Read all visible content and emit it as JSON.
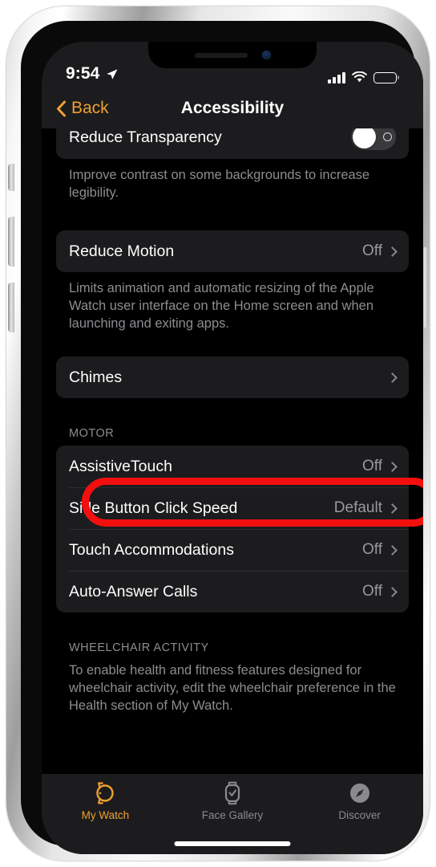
{
  "status_bar": {
    "time": "9:54",
    "location_icon": "location-arrow-icon",
    "signal_icon": "cellular-signal-icon",
    "wifi_icon": "wifi-icon",
    "battery_icon": "battery-full-icon"
  },
  "nav_bar": {
    "back_label": "Back",
    "back_icon": "chevron-left-icon",
    "title": "Accessibility",
    "accent_color": "#f0a030"
  },
  "sections": [
    {
      "rows": [
        {
          "label": "Reduce Transparency",
          "control": "toggle",
          "toggle_state": "off"
        }
      ],
      "footnote": "Improve contrast on some backgrounds to increase legibility."
    },
    {
      "rows": [
        {
          "label": "Reduce Motion",
          "value": "Off",
          "control": "disclosure"
        }
      ],
      "footnote": "Limits animation and automatic resizing of the Apple Watch user interface on the Home screen and when launching and exiting apps."
    },
    {
      "rows": [
        {
          "label": "Chimes",
          "value": "",
          "control": "disclosure"
        }
      ],
      "footnote": ""
    },
    {
      "header": "MOTOR",
      "rows": [
        {
          "label": "AssistiveTouch",
          "value": "Off",
          "control": "disclosure",
          "highlighted": true
        },
        {
          "label": "Side Button Click Speed",
          "value": "Default",
          "control": "disclosure"
        },
        {
          "label": "Touch Accommodations",
          "value": "Off",
          "control": "disclosure"
        },
        {
          "label": "Auto-Answer Calls",
          "value": "Off",
          "control": "disclosure"
        }
      ],
      "footnote": ""
    },
    {
      "header": "WHEELCHAIR ACTIVITY",
      "rows": [],
      "footnote": "To enable health and fitness features designed for wheelchair activity, edit the wheelchair preference in the Health section of My Watch."
    }
  ],
  "annotation": {
    "shape": "rounded-rectangle-outline",
    "color": "#f40f0f",
    "target": "AssistiveTouch"
  },
  "tab_bar": {
    "items": [
      {
        "label": "My Watch",
        "icon": "apple-watch-band-icon",
        "active": true
      },
      {
        "label": "Face Gallery",
        "icon": "watch-face-icon",
        "active": false
      },
      {
        "label": "Discover",
        "icon": "compass-icon",
        "active": false
      }
    ],
    "active_color": "#f0a030",
    "inactive_color": "#8a8a8e"
  },
  "home_indicator": "home-indicator-bar"
}
